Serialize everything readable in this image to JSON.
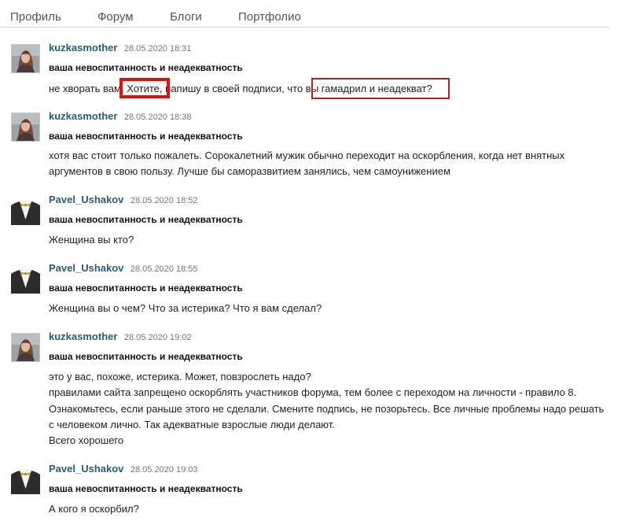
{
  "nav": {
    "items": [
      "Профиль",
      "Форум",
      "Блоги",
      "Портфолио"
    ]
  },
  "colors": {
    "author": "#2b5b77",
    "highlight": "#e01010",
    "highlight_thin": "#b22222"
  },
  "posts": [
    {
      "author": "kuzkasmother",
      "date": "28.05.2020 18:31",
      "subject": "ваша невоспитанность и неадекватность",
      "avatar_icon": "woman-portrait-icon",
      "segments": [
        "не хворать вам. ",
        "Хотите,",
        " напишу в своей подписи, что ",
        "вы гамадрил и неадекват?"
      ]
    },
    {
      "author": "kuzkasmother",
      "date": "28.05.2020 18:38",
      "subject": "ваша невоспитанность и неадекватность",
      "avatar_icon": "woman-portrait-icon",
      "lines": [
        "хотя вас стоит только пожалеть. Сорокалетний мужик обычно переходит на оскорбления, когда нет внятных",
        "аргументов в свою пользу. Лучше бы саморазвитием занялись, чем самоунижением"
      ]
    },
    {
      "author": "Pavel_Ushakov",
      "date": "28.05.2020 18:52",
      "subject": "ваша невоспитанность и неадекватность",
      "avatar_icon": "tuxedo-bowtie-icon",
      "lines": [
        "Женщина вы кто?"
      ]
    },
    {
      "author": "Pavel_Ushakov",
      "date": "28.05.2020 18:55",
      "subject": "ваша невоспитанность и неадекватность",
      "avatar_icon": "tuxedo-bowtie-icon",
      "lines": [
        "Женщина вы о чем? Что за истерика? Что я вам сделал?"
      ]
    },
    {
      "author": "kuzkasmother",
      "date": "28.05.2020 19:02",
      "subject": "ваша невоспитанность и неадекватность",
      "avatar_icon": "woman-portrait-icon",
      "lines": [
        "это у вас, похоже, истерика. Может, повзрослеть надо?",
        "правилами сайта запрещено оскорблять участников форума, тем более с переходом на личности - правило 8.",
        "Ознакомьтесь, если раньше этого не сделали. Смените подпись, не позорьтесь. Все личные проблемы надо решать",
        "с человеком лично. Так адекватные взрослые люди делают.",
        "Всего хорошего"
      ]
    },
    {
      "author": "Pavel_Ushakov",
      "date": "28.05.2020 19:03",
      "subject": "ваша невоспитанность и неадекватность",
      "avatar_icon": "tuxedo-bowtie-icon",
      "lines": [
        "А кого я оскорбил?"
      ]
    }
  ]
}
